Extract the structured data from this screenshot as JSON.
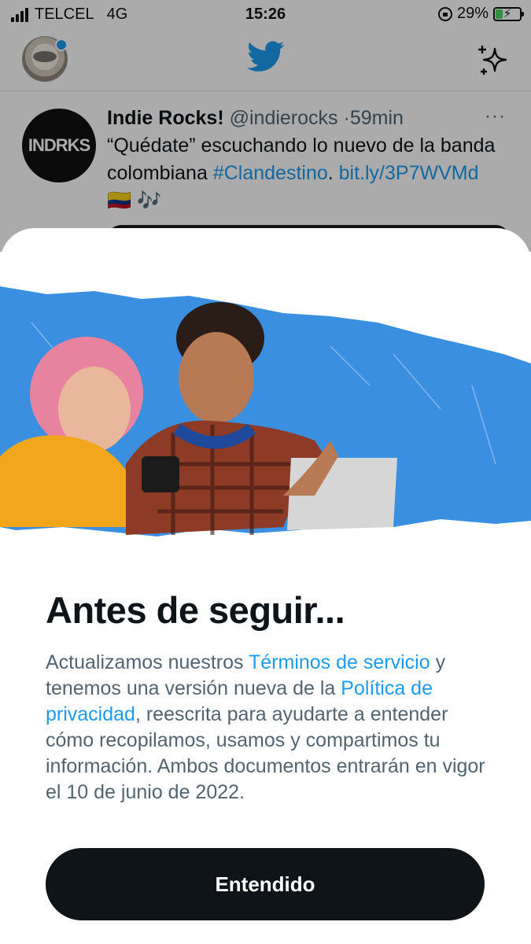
{
  "status_bar": {
    "carrier": "TELCEL",
    "network": "4G",
    "time": "15:26",
    "battery_percent": "29%",
    "battery_level": 0.29,
    "signal_bars": 4,
    "charging": true
  },
  "header": {
    "avatar_icon": "profile-avatar",
    "logo_icon": "twitter-bird-icon",
    "sparkle_icon": "sparkle-icon",
    "notification_dot_color": "#1d9bf0"
  },
  "tweet": {
    "avatar_text": "INDRKS",
    "name": "Indie Rocks!",
    "handle": "@indierocks",
    "separator": "·",
    "time": "59min",
    "more": "···",
    "text_part1": "“Quédate” escuchando lo nuevo de la banda colombiana ",
    "hashtag": "#Clandestino",
    "text_part2": ". ",
    "link": "bit.ly/3P7WVMd",
    "emoji": "🇨🇴 🎶"
  },
  "modal": {
    "title": "Antes de seguir...",
    "body_part1": "Actualizamos nuestros ",
    "link_terms": "Términos de servicio",
    "body_part2": " y tenemos una versión nueva de la ",
    "link_privacy": "Política de privacidad",
    "body_part3": ", reescrita para ayudarte a entender cómo recopilamos, usamos y compartimos tu información. Ambos documentos entrarán en vigor el 10 de junio de 2022.",
    "button_label": "Entendido"
  },
  "colors": {
    "accent": "#1d9bf0",
    "button_bg": "#0f1419",
    "text_primary": "#0f1419",
    "text_secondary": "#536471",
    "hero_blue": "#3b8fe0"
  }
}
